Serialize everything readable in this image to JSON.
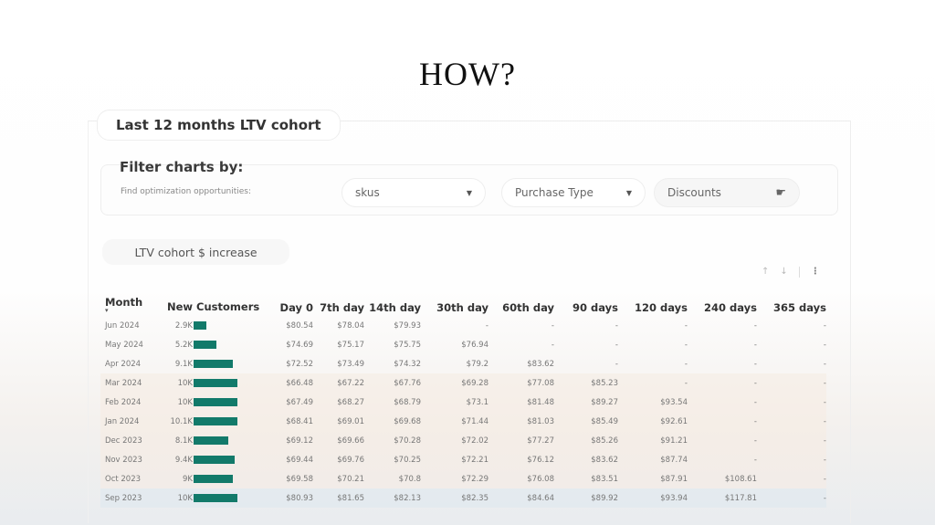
{
  "headline": "HOW?",
  "section_title": "Last 12 months LTV cohort",
  "filters": {
    "title": "Filter charts by:",
    "subtitle": "Find optimization opportunities:",
    "dropdowns": [
      {
        "value": "skus"
      },
      {
        "value": "Purchase Type"
      },
      {
        "value": "Discounts"
      }
    ]
  },
  "view_pill": "LTV cohort $ increase",
  "toolbar": {
    "up": "↑",
    "down": "↓",
    "more": "⋮"
  },
  "table": {
    "headers": [
      "Month",
      "New Customers",
      "Day 0",
      "7th day",
      "14th day",
      "30th day",
      "60th day",
      "90 days",
      "120 days",
      "240 days",
      "365 days"
    ],
    "sort_indicator": "▾",
    "bar_color": "#127a6a",
    "max_customers": 10.1,
    "rows": [
      {
        "month": "Jun 2024",
        "customers": "2.9K",
        "customers_k": 2.9,
        "values": [
          "$80.54",
          "$78.04",
          "$79.93",
          "-",
          "-",
          "-",
          "-",
          "-",
          "-"
        ]
      },
      {
        "month": "May 2024",
        "customers": "5.2K",
        "customers_k": 5.2,
        "values": [
          "$74.69",
          "$75.17",
          "$75.75",
          "$76.94",
          "-",
          "-",
          "-",
          "-",
          "-"
        ]
      },
      {
        "month": "Apr 2024",
        "customers": "9.1K",
        "customers_k": 9.1,
        "values": [
          "$72.52",
          "$73.49",
          "$74.32",
          "$79.2",
          "$83.62",
          "-",
          "-",
          "-",
          "-"
        ]
      },
      {
        "month": "Mar 2024",
        "customers": "10K",
        "customers_k": 10,
        "values": [
          "$66.48",
          "$67.22",
          "$67.76",
          "$69.28",
          "$77.08",
          "$85.23",
          "-",
          "-",
          "-"
        ]
      },
      {
        "month": "Feb 2024",
        "customers": "10K",
        "customers_k": 10,
        "values": [
          "$67.49",
          "$68.27",
          "$68.79",
          "$73.1",
          "$81.48",
          "$89.27",
          "$93.54",
          "-",
          "-"
        ]
      },
      {
        "month": "Jan 2024",
        "customers": "10.1K",
        "customers_k": 10.1,
        "values": [
          "$68.41",
          "$69.01",
          "$69.68",
          "$71.44",
          "$81.03",
          "$85.49",
          "$92.61",
          "-",
          "-"
        ]
      },
      {
        "month": "Dec 2023",
        "customers": "8.1K",
        "customers_k": 8.1,
        "values": [
          "$69.12",
          "$69.66",
          "$70.28",
          "$72.02",
          "$77.27",
          "$85.26",
          "$91.21",
          "-",
          "-"
        ]
      },
      {
        "month": "Nov 2023",
        "customers": "9.4K",
        "customers_k": 9.4,
        "values": [
          "$69.44",
          "$69.76",
          "$70.25",
          "$72.21",
          "$76.12",
          "$83.62",
          "$87.74",
          "-",
          "-"
        ]
      },
      {
        "month": "Oct 2023",
        "customers": "9K",
        "customers_k": 9,
        "values": [
          "$69.58",
          "$70.21",
          "$70.8",
          "$72.29",
          "$76.08",
          "$83.51",
          "$87.91",
          "$108.61",
          "-"
        ]
      },
      {
        "month": "Sep 2023",
        "customers": "10K",
        "customers_k": 10,
        "values": [
          "$80.93",
          "$81.65",
          "$82.13",
          "$82.35",
          "$84.64",
          "$89.92",
          "$93.94",
          "$117.81",
          "-"
        ]
      }
    ]
  }
}
